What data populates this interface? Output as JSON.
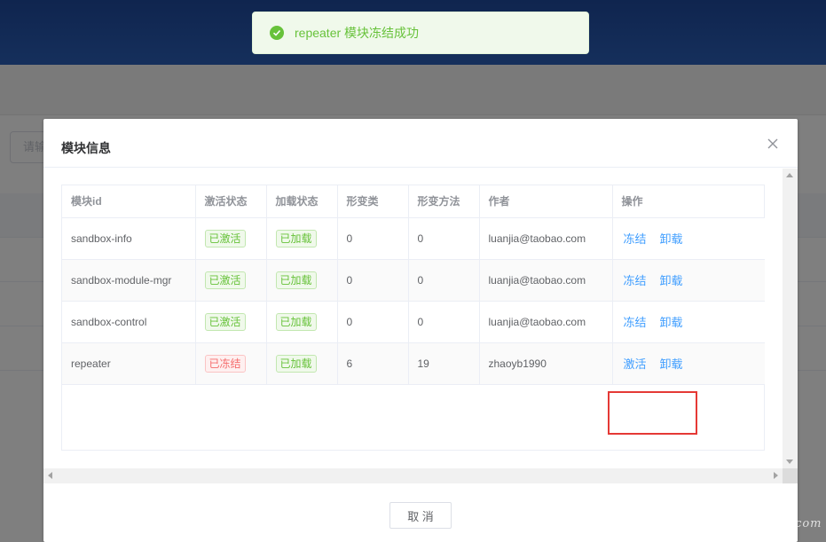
{
  "background": {
    "search_placeholder": "请输"
  },
  "toast": {
    "message": "repeater 模块冻结成功",
    "type": "success",
    "icon": "check-circle-icon"
  },
  "dialog": {
    "title": "模块信息",
    "close_icon": "close-icon",
    "cancel_label": "取 消"
  },
  "table": {
    "columns": [
      "模块id",
      "激活状态",
      "加载状态",
      "形变类",
      "形变方法",
      "作者",
      "操作"
    ],
    "rows": [
      {
        "id": "sandbox-info",
        "active": "已激活",
        "active_state": "success",
        "loaded": "已加载",
        "cls": "0",
        "method": "0",
        "author": "luanjia@taobao.com",
        "action1": "冻结",
        "action2": "卸载"
      },
      {
        "id": "sandbox-module-mgr",
        "active": "已激活",
        "active_state": "success",
        "loaded": "已加载",
        "cls": "0",
        "method": "0",
        "author": "luanjia@taobao.com",
        "action1": "冻结",
        "action2": "卸载"
      },
      {
        "id": "sandbox-control",
        "active": "已激活",
        "active_state": "success",
        "loaded": "已加载",
        "cls": "0",
        "method": "0",
        "author": "luanjia@taobao.com",
        "action1": "冻结",
        "action2": "卸载"
      },
      {
        "id": "repeater",
        "active": "已冻结",
        "active_state": "danger",
        "loaded": "已加载",
        "cls": "6",
        "method": "19",
        "author": "zhaoyb1990",
        "action1": "激活",
        "action2": "卸载"
      }
    ]
  },
  "colors": {
    "success": "#67c23a",
    "danger": "#f56c6c",
    "link": "#409eff",
    "highlight_box": "#e53935"
  },
  "watermark": "testerhome.com"
}
